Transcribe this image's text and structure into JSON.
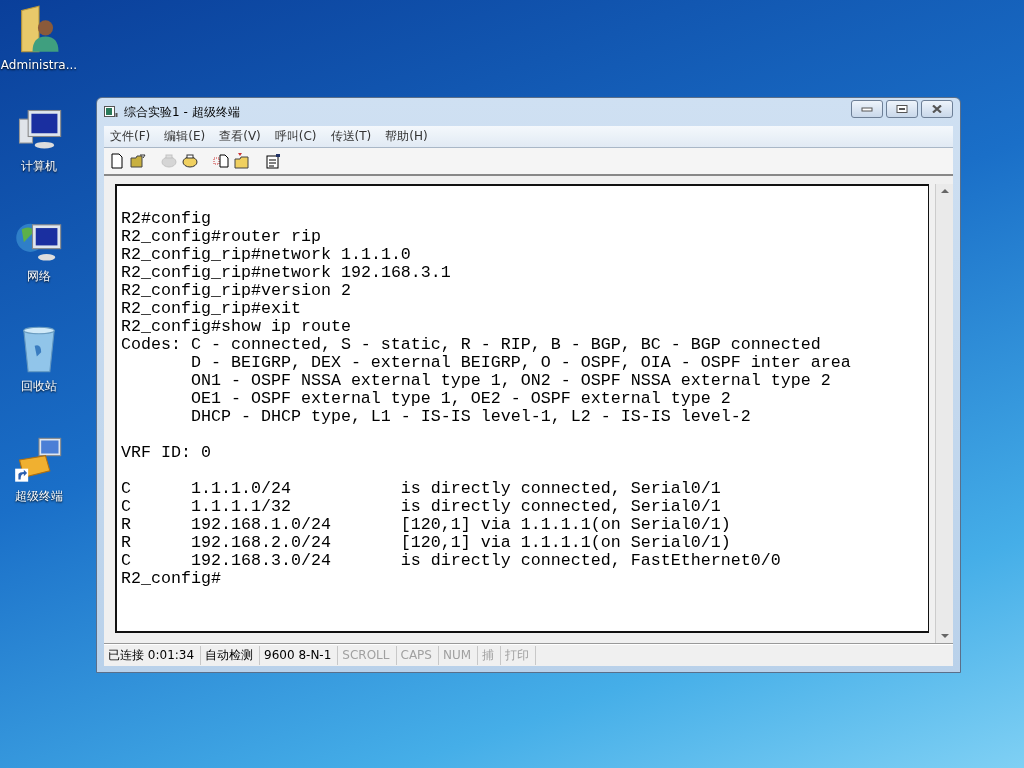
{
  "desktop_icons": [
    {
      "kind": "user-folder",
      "label": "Administra..."
    },
    {
      "kind": "computer",
      "label": "计算机"
    },
    {
      "kind": "network",
      "label": "网络"
    },
    {
      "kind": "recycle-bin",
      "label": "回收站"
    },
    {
      "kind": "terminal-shortcut",
      "label": "超级终端"
    }
  ],
  "window": {
    "title": "综合实验1 - 超级终端",
    "menu": [
      "文件(F)",
      "编辑(E)",
      "查看(V)",
      "呼叫(C)",
      "传送(T)",
      "帮助(H)"
    ],
    "toolbar": [
      {
        "kind": "new",
        "disabled": false
      },
      {
        "kind": "open",
        "disabled": false
      },
      {
        "kind": "call",
        "disabled": true
      },
      {
        "kind": "hangup",
        "disabled": false
      },
      {
        "kind": "send",
        "disabled": false
      },
      {
        "kind": "receive",
        "disabled": false
      },
      {
        "kind": "properties",
        "disabled": false
      }
    ],
    "terminal": {
      "commands": [
        "R2#config",
        "R2_config#router rip",
        "R2_config_rip#network 1.1.1.0",
        "R2_config_rip#network 192.168.3.1",
        "R2_config_rip#version 2",
        "R2_config_rip#exit",
        "R2_config#show ip route"
      ],
      "codes": {
        "label": "Codes:",
        "lines": [
          "C - connected, S - static, R - RIP, B - BGP, BC - BGP connected",
          "D - BEIGRP, DEX - external BEIGRP, O - OSPF, OIA - OSPF inter area",
          "ON1 - OSPF NSSA external type 1, ON2 - OSPF NSSA external type 2",
          "OE1 - OSPF external type 1, OE2 - OSPF external type 2",
          "DHCP - DHCP type, L1 - IS-IS level-1, L2 - IS-IS level-2"
        ]
      },
      "vrf": "VRF ID: 0",
      "routes": [
        {
          "code": "C",
          "network": "1.1.1.0/24",
          "detail": "is directly connected, Serial0/1"
        },
        {
          "code": "C",
          "network": "1.1.1.1/32",
          "detail": "is directly connected, Serial0/1"
        },
        {
          "code": "R",
          "network": "192.168.1.0/24",
          "detail": "[120,1] via 1.1.1.1(on Serial0/1)"
        },
        {
          "code": "R",
          "network": "192.168.2.0/24",
          "detail": "[120,1] via 1.1.1.1(on Serial0/1)"
        },
        {
          "code": "C",
          "network": "192.168.3.0/24",
          "detail": "is directly connected, FastEthernet0/0"
        }
      ],
      "prompt": "R2_config#"
    },
    "status_bar": [
      {
        "text": "已连接 0:01:34",
        "disabled": false
      },
      {
        "text": "自动检测",
        "disabled": false
      },
      {
        "text": "9600 8-N-1",
        "disabled": false
      },
      {
        "text": "SCROLL",
        "disabled": true
      },
      {
        "text": "CAPS",
        "disabled": true
      },
      {
        "text": "NUM",
        "disabled": true
      },
      {
        "text": "捕",
        "disabled": true
      },
      {
        "text": "打印",
        "disabled": true
      }
    ]
  }
}
